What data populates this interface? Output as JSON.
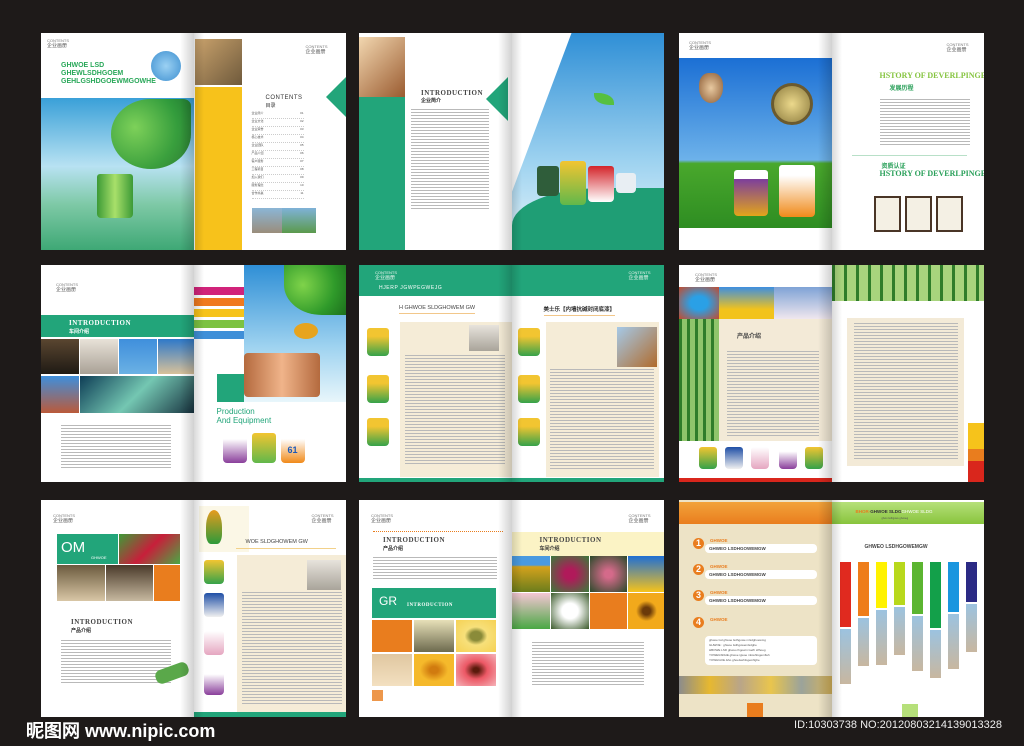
{
  "header_tag": {
    "en": "CONTENTS",
    "cn": "企业画册"
  },
  "spread1": {
    "headline": [
      "GHWOE LSD",
      "GHEWLSDHGOEM",
      "GEHLGSHDGOEWMGOWHE"
    ],
    "contents_title": "CONTENTS",
    "contents_cn": "目录",
    "toc": [
      {
        "label": "企业简介",
        "page": "01"
      },
      {
        "label": "企业文化",
        "page": "02"
      },
      {
        "label": "企业荣誉",
        "page": "03"
      },
      {
        "label": "核心技术",
        "page": "04"
      },
      {
        "label": "企业团队",
        "page": "05"
      },
      {
        "label": "产品介绍",
        "page": "06"
      },
      {
        "label": "客户服务",
        "page": "07"
      },
      {
        "label": "工程项目",
        "page": "08"
      },
      {
        "label": "加入我们",
        "page": "09"
      },
      {
        "label": "服务理念",
        "page": "10"
      },
      {
        "label": "合作共赢",
        "page": "11"
      }
    ]
  },
  "spread2": {
    "title": "INTRODUCTION",
    "cn": "企业简介"
  },
  "spread3": {
    "history_title": "HSTORY OF DEVERLPINGE",
    "history_cn": "发展历程",
    "cert_cn": "资质认证",
    "cert_title": "HSTORY OF DEVERLPINGE"
  },
  "spread4": {
    "title": "INTRODUCTION",
    "cn": "车间介绍",
    "production": "Production",
    "equipment": "And Equipment",
    "can_label": "61"
  },
  "spread5": {
    "banner": "HJERP  JGWPEGWEJG",
    "left_heading": "H GHWOE SLDGHOWEM GW",
    "right_heading": "美士乐【内墙抗碱封闭底漆】"
  },
  "spread6": {
    "heading": "产品介绍"
  },
  "spread7": {
    "om": "OM",
    "om_sub": "GHWOE",
    "heading": "WOE SLDGHOWEM GW",
    "title": "INTRODUCTION",
    "cn": "产品介绍"
  },
  "spread8": {
    "title": "INTRODUCTION",
    "cn": "产品介绍",
    "gr": "GR",
    "gr_title": "INTRODUCTION",
    "right_title": "INTRODUCTION",
    "right_cn": "车间介绍"
  },
  "spread9": {
    "steps": [
      {
        "num": "1",
        "label": "GHWOE",
        "text": "GHWEO LSDHGOWEMGW"
      },
      {
        "num": "2",
        "label": "GHWOE",
        "text": "GHWEO LSDHGOWEMGW"
      },
      {
        "num": "3",
        "label": "GHWOE",
        "text": "GHWEO LSDHGOWEMGW"
      },
      {
        "num": "4",
        "label": "GHWOE"
      }
    ],
    "step4_lines": [
      "ghwoe lsd ghwoe lsdhgowe mlsdghoewmg",
      "GHWOE : ghwoe lsdhgowemlsdghe",
      "HBOWE LSD ghweo lhgowm lsefh slfhoeg",
      "YOWEGSDHE ghwoe igwoe mlswhfogemfleh",
      "YOWHGOE.lsho ghoelswhfogemflghe"
    ],
    "banner_orange": "BHOR-",
    "banner_dark": "GHWOE SLDG",
    "banner_light": "GHWOE SLDG",
    "banner_sub": "ghwo lsdhgowe ghwoeg",
    "title": "GHWEO LSDHGOWEMGW",
    "bar_colors": [
      "#e02a1f",
      "#ee7d1a",
      "#fff200",
      "#b8d81c",
      "#5cb531",
      "#13a04a",
      "#1a96df",
      "#2b2a84"
    ]
  },
  "footer": {
    "site": "昵图网 www.nipic.com",
    "id": "ID:10303738 NO:20120803214139013328"
  }
}
